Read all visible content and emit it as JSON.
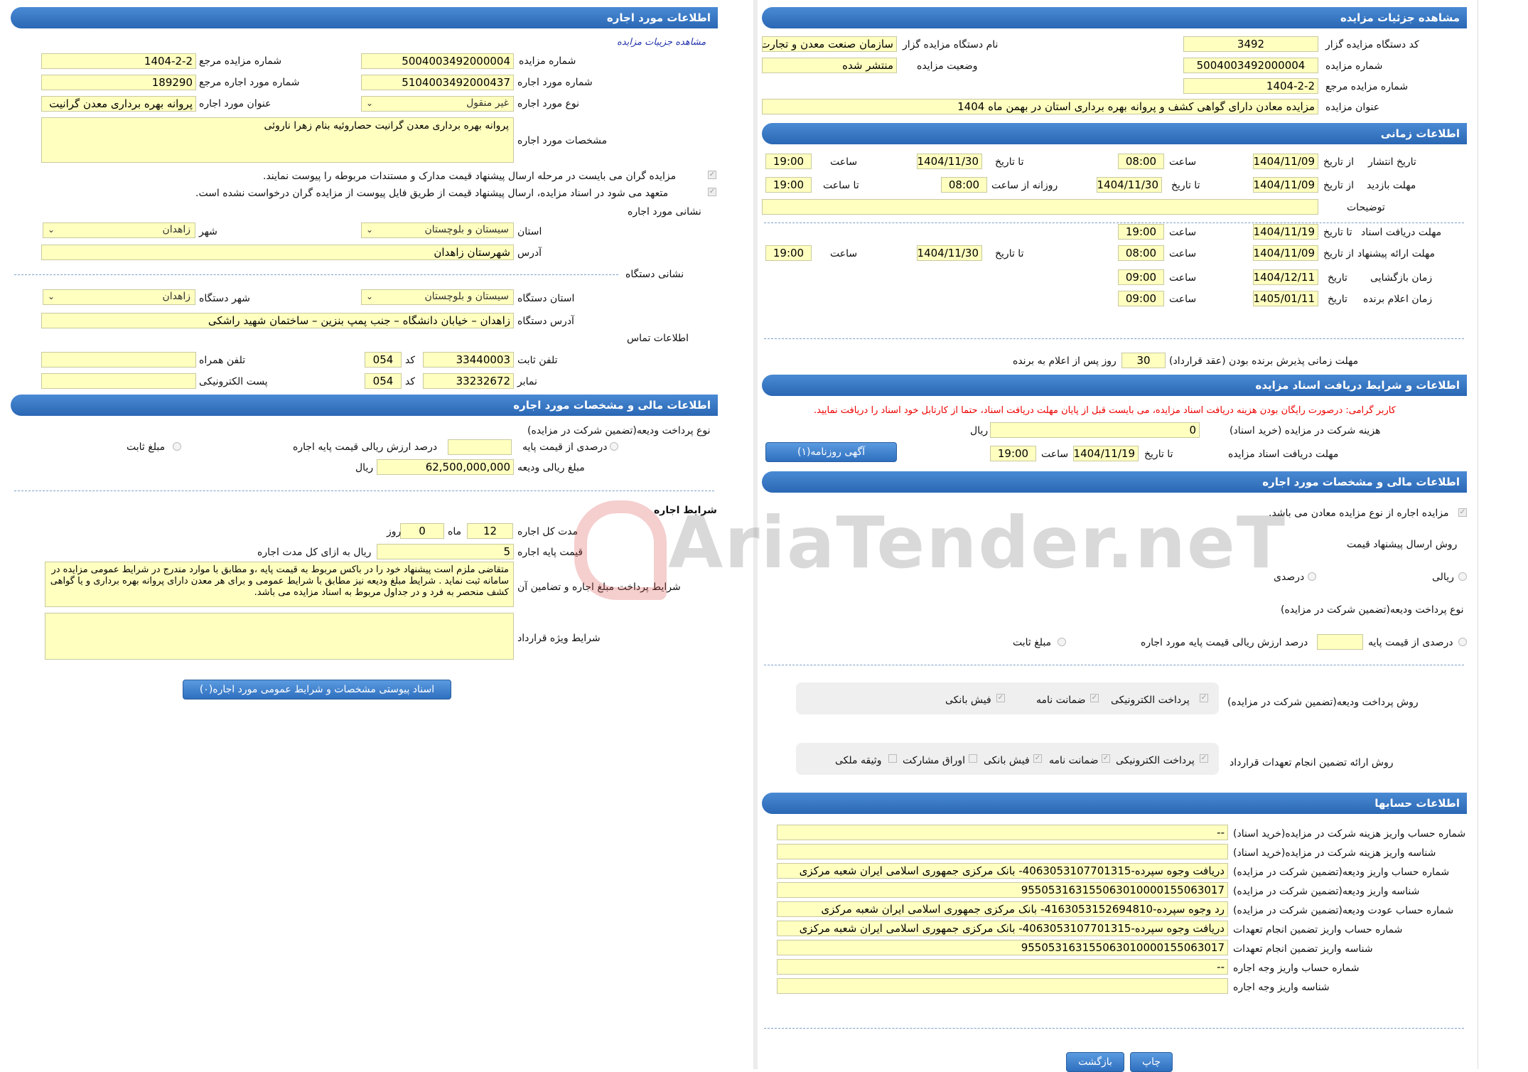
{
  "left": {
    "h_lease_info": "اطلاعات مورد اجاره",
    "link_auction_details": "مشاهده جزییات مزایده",
    "l_auction_no": "شماره مزایده",
    "v_auction_no": "5004003492000004",
    "l_ref_auction_no": "شماره مزایده مرجع",
    "v_ref_auction_no": "1404-2-2",
    "l_lease_no": "شماره مورد اجاره",
    "v_lease_no": "5104003492000437",
    "l_ref_lease_no": "شماره مورد اجاره مرجع",
    "v_ref_lease_no": "189290",
    "l_lease_type": "نوع مورد اجاره",
    "v_lease_type": "غیر منقول",
    "l_lease_title": "عنوان مورد اجاره",
    "v_lease_title": "پروانه بهره برداری معدن گرانیت",
    "l_lease_specs": "مشخصات مورد اجاره",
    "v_lease_specs": "پروانه بهره برداری معدن گرانیت حصاروئیه بنام زهرا ناروئی",
    "note1": "مزایده گران می بایست در مرحله ارسال پیشنهاد قیمت مدارک و مستندات مربوطه را پیوست نمایند.",
    "note2": "متعهد می شود در اسناد مزایده، ارسال پیشنهاد قیمت از طریق فایل پیوست از مزایده گران درخواست نشده است.",
    "l_lease_address": "نشانی مورد اجاره",
    "l_province": "استان",
    "v_province": "سیستان و بلوچستان",
    "l_city": "شهر",
    "v_city": "زاهدان",
    "l_address": "آدرس",
    "v_address": "شهرستان زاهدان",
    "l_device_address": "نشانی دستگاه",
    "l_device_province": "استان دستگاه",
    "v_device_province": "سیستان و بلوچستان",
    "l_device_city": "شهر دستگاه",
    "v_device_city": "زاهدان",
    "l_device_addr": "آدرس دستگاه",
    "v_device_addr": "زاهدان – خیابان دانشگاه – جنب پمپ بنزین – ساختمان شهید راشکی",
    "l_contact": "اطلاعات تماس",
    "l_phone": "تلفن ثابت",
    "v_phone": "33440003",
    "l_code": "کد",
    "v_code": "054",
    "l_mobile": "تلفن همراه",
    "v_mobile": "",
    "l_fax": "نمابر",
    "v_fax": "33232672",
    "v_fax_code": "054",
    "l_email": "پست الکترونیکی",
    "v_email": "",
    "h_financial": "اطلاعات مالی و مشخصات مورد اجاره",
    "l_deposit_type": "نوع پرداخت ودیعه(تضمین شرکت در مزایده)",
    "l_percent_base": "درصدی از قیمت پایه",
    "l_percent_value": "درصد ارزش ریالی قیمت پایه اجاره",
    "l_fixed": "مبلغ ثابت",
    "l_deposit_amount": "مبلغ ریالی ودیعه",
    "v_deposit_amount": "62,500,000,000",
    "l_rial": "ریال",
    "l_lease_terms": "شرایط اجاره",
    "l_duration": "مدت کل اجاره",
    "v_months": "12",
    "l_month": "ماه",
    "v_days": "0",
    "l_day": "روز",
    "l_base_price": "قیمت پایه اجاره",
    "v_base_price": "5",
    "l_base_price_unit": "ریال به ازای کل مدت اجاره",
    "l_payment_terms": "شرایط پرداخت مبلغ اجاره و تضامین آن",
    "v_payment_terms": "متقاضی ملزم است پیشنهاد خود را در باکس مربوط به قیمت پایه ،و مطابق با موارد مندرج در شرایط عمومی مزایده در سامانه ثبت نماید . شرایط مبلغ ودیعه نیز مطابق با شرایط عمومی و برای هر معدن دارای پروانه بهره برداری و یا گواهی کشف منحصر به فرد و در جداول مربوط به اسناد مزایده می باشد.",
    "l_special_terms": "شرایط ویژه قرارداد",
    "v_special_terms": "",
    "btn_attachments": "اسناد پیوستی مشخصات و شرایط عمومی مورد اجاره(۰)"
  },
  "right": {
    "h_details": "مشاهده جزئیات مزایده",
    "l_org_code": "کد دستگاه مزایده گزار",
    "v_org_code": "3492",
    "l_org_name": "نام دستگاه مزایده گزار",
    "v_org_name": "سازمان صنعت معدن و تجارت",
    "l_auction_no": "شماره مزایده",
    "v_auction_no": "5004003492000004",
    "l_status": "وضعیت مزایده",
    "v_status": "منتشر شده",
    "l_ref_no": "شماره مزایده مرجع",
    "v_ref_no": "1404-2-2",
    "l_title": "عنوان مزایده",
    "v_title": "مزایده معادن دارای گواهی کشف و پروانه بهره برداری استان در بهمن ماه 1404",
    "h_timing": "اطلاعات زمانی",
    "l_publish": "تاریخ انتشار",
    "l_from_date": "از تاریخ",
    "l_to_date": "تا تاریخ",
    "l_time": "ساعت",
    "v_publish_from": "1404/11/09",
    "v_publish_from_t": "08:00",
    "v_publish_to": "1404/11/30",
    "v_publish_to_t": "19:00",
    "l_visit": "مهلت بازدید",
    "v_visit_from": "1404/11/09",
    "v_visit_to": "1404/11/30",
    "l_daily_from": "روزانه از ساعت",
    "v_daily_from": "08:00",
    "l_to_time": "تا ساعت",
    "v_daily_to": "19:00",
    "l_desc": "توضیحات",
    "v_desc": "",
    "l_doc_receive": "مهلت دریافت اسناد",
    "v_doc_to": "1404/11/19",
    "v_doc_to_t": "19:00",
    "l_offer": "مهلت ارائه پیشنهاد",
    "v_offer_from": "1404/11/09",
    "v_offer_from_t": "08:00",
    "v_offer_to": "1404/11/30",
    "v_offer_to_t": "19:00",
    "l_opening": "زمان بازگشایی",
    "l_date": "تاریخ",
    "v_opening": "1404/12/11",
    "v_opening_t": "09:00",
    "l_winner": "زمان اعلام برنده",
    "v_winner": "1405/01/11",
    "v_winner_t": "09:00",
    "l_accept": "مهلت زمانی پذیرش برنده بودن (عقد قرارداد)",
    "v_accept": "30",
    "l_accept_unit": "روز پس از اعلام به برنده",
    "h_docs": "اطلاعات و شرایط دریافت اسناد مزایده",
    "red_note": "کاربر گرامی: درصورت رایگان بودن هزینه دریافت اسناد مزایده، می بایست قبل از پایان مهلت دریافت اسناد، حتما از کارتابل خود اسناد را دریافت نمایید.",
    "l_doc_fee": "هزینه شرکت در مزایده (خرید اسناد)",
    "v_doc_fee": "0",
    "l_rial": "ریال",
    "l_doc_deadline": "مهلت دریافت اسناد مزایده",
    "v_doc_deadline": "1404/11/19",
    "v_doc_deadline_t": "19:00",
    "btn_newspaper": "آگهی روزنامه(۱)",
    "h_financial": "اطلاعات مالی و مشخصات مورد اجاره",
    "l_mine_note": "مزایده اجاره از نوع مزایده معادن می باشد.",
    "l_price_method": "روش ارسال پیشنهاد قیمت",
    "l_percent": "درصدی",
    "l_rial_opt": "ریالی",
    "l_deposit_type": "نوع پرداخت ودیعه(تضمین شرکت در مزایده)",
    "l_percent_base": "درصدی از قیمت پایه",
    "l_percent_value": "درصد ارزش ریالی قیمت پایه مورد اجاره",
    "l_fixed": "مبلغ ثابت",
    "l_deposit_method": "روش پرداخت ودیعه(تضمین شرکت در مزایده)",
    "o_electronic": "پرداخت الکترونیکی",
    "o_guarantee": "ضمانت نامه",
    "o_bank_slip": "فیش بانکی",
    "l_commit_method": "روش ارائه تضمین انجام تعهدات قرارداد",
    "o_bonds": "اوراق مشارکت",
    "o_property": "وثیقه ملکی",
    "h_accounts": "اطلاعات حسابها",
    "l_acc1": "شماره حساب واریز هزینه شرکت در مزایده(خرید اسناد)",
    "v_acc1": "--",
    "l_acc2": "شناسه واریز هزینه شرکت در مزایده(خرید اسناد)",
    "v_acc2": "",
    "l_acc3": "شماره حساب واریز ودیعه(تضمین شرکت در مزایده)",
    "v_acc3": "دریافت وجوه سپرده-4063053107701315- بانک مرکزی جمهوری اسلامی ایران شعبه مرکزی",
    "l_acc4": "شناسه واریز ودیعه(تضمین شرکت در مزایده)",
    "v_acc4": "955053163155063010000155063017",
    "l_acc5": "شماره حساب عودت ودیعه(تضمین شرکت در مزایده)",
    "v_acc5": "رد وجوه سپرده-4163053152694810- بانک مرکزی جمهوری اسلامی ایران شعبه مرکزی",
    "l_acc6": "شماره حساب واریز تضمین انجام تعهدات",
    "v_acc6": "دریافت وجوه سپرده-4063053107701315- بانک مرکزی جمهوری اسلامی ایران شعبه مرکزی",
    "l_acc7": "شناسه واریز تضمین انجام تعهدات",
    "v_acc7": "955053163155063010000155063017",
    "l_acc8": "شماره حساب واریز وجه اجاره",
    "v_acc8": "--",
    "l_acc9": "شناسه واریز وجه اجاره",
    "v_acc9": "",
    "btn_print": "چاپ",
    "btn_back": "بازگشت"
  },
  "watermark": "AriaTender.neT",
  "colors": {
    "header": "#2a67b4",
    "field": "#ffffc0",
    "red": "#e00000"
  }
}
